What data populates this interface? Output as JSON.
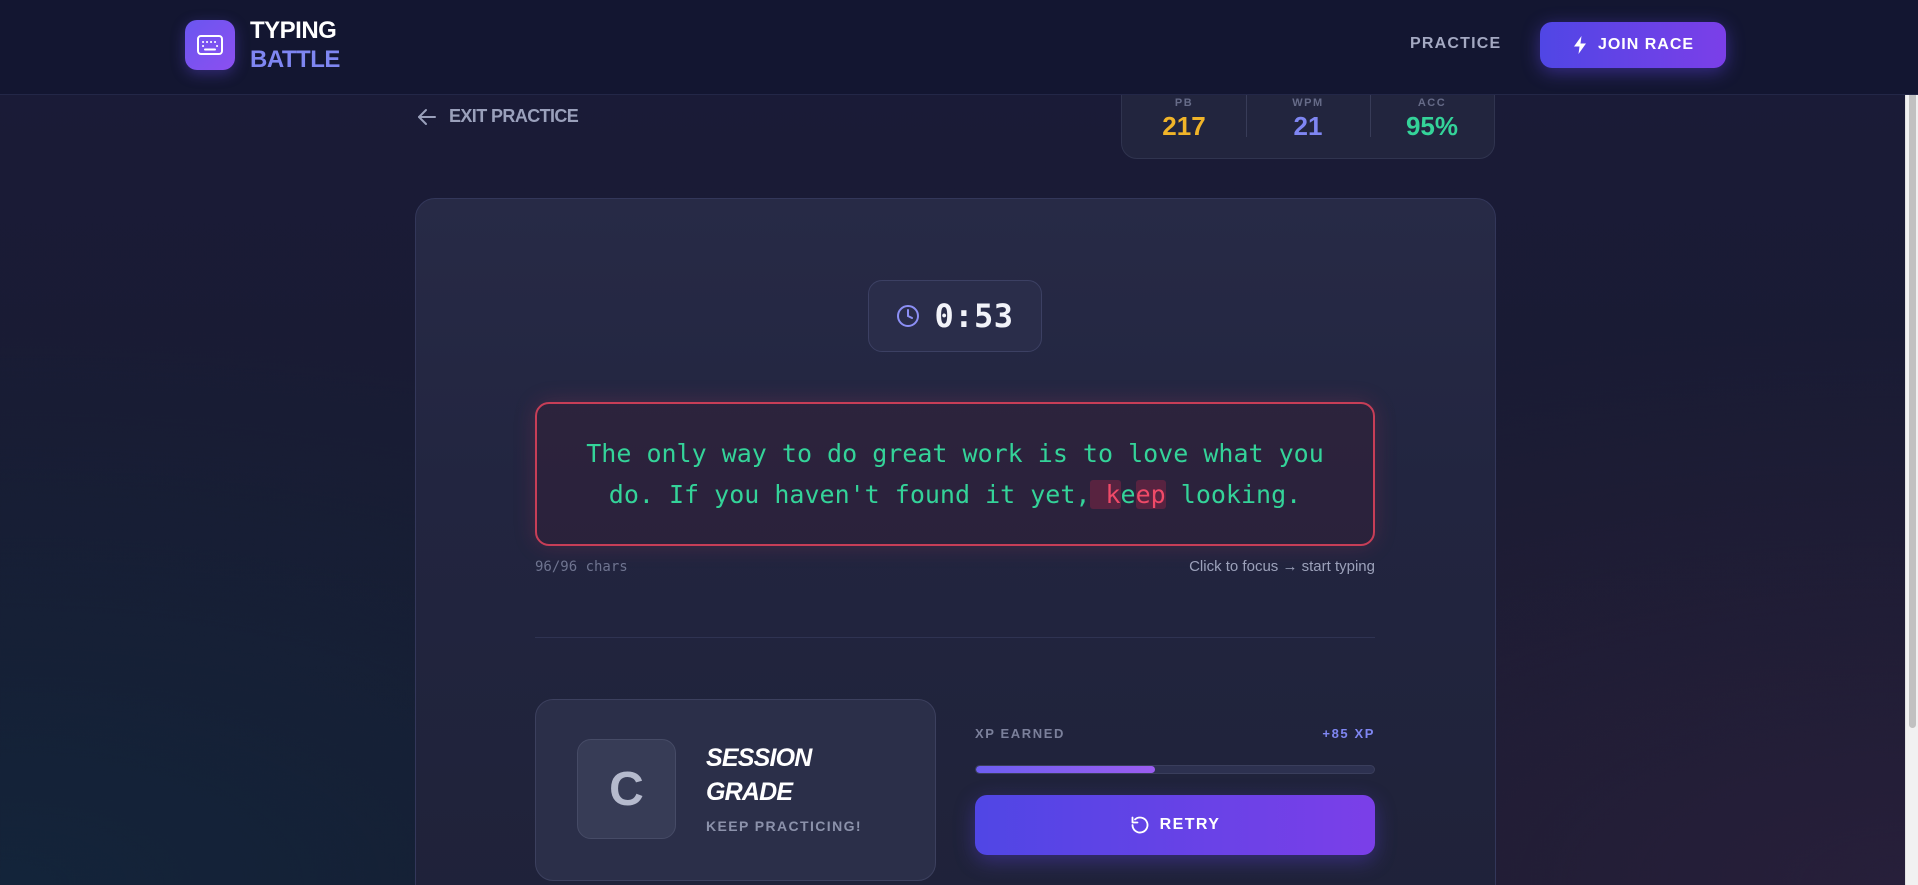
{
  "header": {
    "logo_line1": "TYPING",
    "logo_line2": "BATTLE",
    "logo_icon": "keyboard-icon",
    "nav_practice": "PRACTICE",
    "join_race": "JOIN RACE",
    "join_icon": "bolt-icon"
  },
  "subbar": {
    "exit_label": "EXIT PRACTICE",
    "exit_icon": "arrow-left-icon"
  },
  "stats": [
    {
      "label": "PB",
      "value": "217",
      "color": "#f0b429"
    },
    {
      "label": "WPM",
      "value": "21",
      "color": "#7f86f2"
    },
    {
      "label": "ACC",
      "value": "95%",
      "color": "#34d399"
    }
  ],
  "timer": {
    "icon": "clock-icon",
    "value": "0:53"
  },
  "passage": {
    "correct_before": "The only way to do great work is to love what you do. If you haven't found it yet,",
    "error_1": " k",
    "correct_mid": "e",
    "error_2": "ep",
    "correct_after": " looking."
  },
  "progress": {
    "chars": "96/96 chars",
    "hint": "Click to focus → start typing"
  },
  "grade": {
    "letter": "C",
    "title": "SESSION GRADE",
    "subtitle": "KEEP PRACTICING!"
  },
  "xp": {
    "label": "XP EARNED",
    "value": "+85 XP",
    "progress_fraction": 0.45
  },
  "retry": {
    "label": "RETRY",
    "icon": "rotate-ccw-icon"
  },
  "colors": {
    "accent": "#5046e5",
    "correct": "#34d399",
    "error": "#f04a68"
  }
}
